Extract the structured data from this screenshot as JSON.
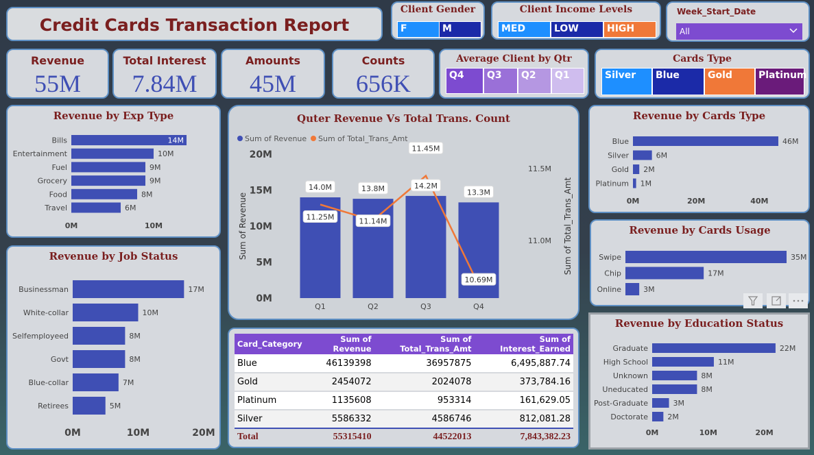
{
  "report_title": "Credit Cards Transaction Report",
  "slicers": {
    "gender": {
      "title": "Client Gender",
      "options": [
        {
          "label": "F",
          "color": "#1e8fff"
        },
        {
          "label": "M",
          "color": "#1b2aa8"
        }
      ]
    },
    "income": {
      "title": "Client Income Levels",
      "options": [
        {
          "label": "MED",
          "color": "#1e8fff"
        },
        {
          "label": "LOW",
          "color": "#1b2aa8"
        },
        {
          "label": "HIGH",
          "color": "#f07838"
        }
      ]
    },
    "week": {
      "title": "Week_Start_Date",
      "value": "All",
      "accent": "#7d4bd0"
    },
    "qtr": {
      "title": "Average Client by Qtr",
      "options": [
        {
          "label": "Q4",
          "color": "#7d4bd0"
        },
        {
          "label": "Q3",
          "color": "#9a70d8"
        },
        {
          "label": "Q2",
          "color": "#b597e2"
        },
        {
          "label": "Q1",
          "color": "#cfbdee"
        }
      ]
    },
    "cards_type": {
      "title": "Cards Type",
      "options": [
        {
          "label": "Silver",
          "color": "#1e8fff"
        },
        {
          "label": "Blue",
          "color": "#1b2aa8"
        },
        {
          "label": "Gold",
          "color": "#f07838"
        },
        {
          "label": "Platinum",
          "color": "#6a1b7a"
        }
      ]
    }
  },
  "kpis": {
    "revenue": {
      "label": "Revenue",
      "value": "55M"
    },
    "interest": {
      "label": "Total Interest",
      "value": "7.84M"
    },
    "amounts": {
      "label": "Amounts",
      "value": "45M"
    },
    "counts": {
      "label": "Counts",
      "value": "656K"
    }
  },
  "bar_color": "#3f4fb4",
  "chart_data": [
    {
      "id": "exp",
      "type": "bar",
      "orientation": "horizontal",
      "title": "Revenue by Exp Type",
      "categories": [
        "Bills",
        "Entertainment",
        "Fuel",
        "Grocery",
        "Food",
        "Travel"
      ],
      "values": [
        14,
        10,
        9,
        9,
        8,
        6
      ],
      "labels": [
        "14M",
        "10M",
        "9M",
        "9M",
        "8M",
        "6M"
      ],
      "ticks": [
        "0M",
        "10M"
      ],
      "tick_values": [
        0,
        10
      ],
      "xlim": [
        0,
        14.5
      ],
      "highlight_first": true
    },
    {
      "id": "job",
      "type": "bar",
      "orientation": "horizontal",
      "title": "Revenue by Job Status",
      "categories": [
        "Businessman",
        "White-collar",
        "Selfemployeed",
        "Govt",
        "Blue-collar",
        "Retirees"
      ],
      "values": [
        17,
        10,
        8,
        8,
        7,
        5
      ],
      "labels": [
        "17M",
        "10M",
        "8M",
        "8M",
        "7M",
        "5M"
      ],
      "ticks": [
        "0M",
        "10M",
        "20M"
      ],
      "tick_values": [
        0,
        10,
        20
      ],
      "xlim": [
        0,
        20
      ]
    },
    {
      "id": "combo",
      "type": "bar",
      "title": "Quter Revenue Vs Total Trans. Count",
      "categories": [
        "Q1",
        "Q2",
        "Q3",
        "Q4"
      ],
      "series": [
        {
          "name": "Sum of Revenue",
          "type": "bar",
          "color": "#3f4fb4",
          "values": [
            14.0,
            13.8,
            14.2,
            13.3
          ],
          "labels": [
            "14.0M",
            "13.8M",
            "14.2M",
            "13.3M"
          ]
        },
        {
          "name": "Sum of Total_Trans_Amt",
          "type": "line",
          "color": "#f07838",
          "values": [
            11.25,
            11.14,
            11.45,
            10.69
          ],
          "labels": [
            "11.25M",
            "11.14M",
            "11.45M",
            "10.69M"
          ]
        }
      ],
      "ylabel": "Sum of Revenue",
      "y2label": "Sum of Total_Trans_Amt",
      "yticks": [
        "0M",
        "5M",
        "10M",
        "15M",
        "20M"
      ],
      "ytick_values": [
        0,
        5,
        10,
        15,
        20
      ],
      "ylim": [
        0,
        20
      ],
      "y2ticks": [
        "11.0M",
        "11.5M"
      ],
      "y2tick_values": [
        11.0,
        11.5
      ],
      "y2lim": [
        10.6,
        11.6
      ]
    },
    {
      "id": "ctype",
      "type": "bar",
      "orientation": "horizontal",
      "title": "Revenue by Cards Type",
      "categories": [
        "Blue",
        "Silver",
        "Gold",
        "Platinum"
      ],
      "values": [
        46,
        6,
        2,
        1
      ],
      "labels": [
        "46M",
        "6M",
        "2M",
        "1M"
      ],
      "ticks": [
        "0M",
        "20M",
        "40M"
      ],
      "tick_values": [
        0,
        20,
        40
      ],
      "xlim": [
        0,
        46
      ]
    },
    {
      "id": "usage",
      "type": "bar",
      "orientation": "horizontal",
      "title": "Revenue by Cards Usage",
      "categories": [
        "Swipe",
        "Chip",
        "Online"
      ],
      "values": [
        35,
        17,
        3
      ],
      "labels": [
        "35M",
        "17M",
        "3M"
      ],
      "xlim": [
        0,
        35
      ]
    },
    {
      "id": "edu",
      "type": "bar",
      "orientation": "horizontal",
      "title": "Revenue by Education Status",
      "categories": [
        "Graduate",
        "High School",
        "Unknown",
        "Uneducated",
        "Post-Graduate",
        "Doctorate"
      ],
      "values": [
        22,
        11,
        8,
        8,
        3,
        2
      ],
      "labels": [
        "22M",
        "11M",
        "8M",
        "8M",
        "3M",
        "2M"
      ],
      "ticks": [
        "0M",
        "10M",
        "20M"
      ],
      "tick_values": [
        0,
        10,
        20
      ],
      "xlim": [
        0,
        22.5
      ]
    }
  ],
  "table": {
    "header_color": "#7d4bd0",
    "columns": [
      "Card_Category",
      "Sum of Revenue",
      "Sum of Total_Trans_Amt",
      "Sum of Interest_Earned"
    ],
    "rows": [
      [
        "Blue",
        "46139398",
        "36957875",
        "6,495,887.74"
      ],
      [
        "Gold",
        "2454072",
        "2024078",
        "373,784.16"
      ],
      [
        "Platinum",
        "1135608",
        "953314",
        "161,629.05"
      ],
      [
        "Silver",
        "5586332",
        "4586746",
        "812,081.28"
      ]
    ],
    "total": [
      "Total",
      "55315410",
      "44522013",
      "7,843,382.23"
    ]
  }
}
